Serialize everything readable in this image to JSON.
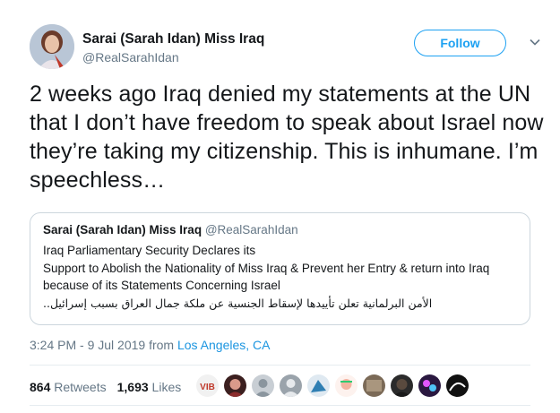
{
  "author": {
    "name": "Sarai (Sarah Idan) Miss Iraq",
    "handle": "@RealSarahIdan"
  },
  "follow_label": "Follow",
  "tweet_text": "2 weeks ago Iraq denied my statements at the UN that I don’t have freedom to speak about Israel now they’re taking my citizenship. This is inhumane. I’m speechless…",
  "quote": {
    "name": "Sarai (Sarah Idan) Miss Iraq",
    "handle": "@RealSarahIdan",
    "lines": [
      "Iraq Parliamentary Security Declares its",
      "Support to Abolish the Nationality of Miss Iraq & Prevent her Entry & return into Iraq",
      "because of its Statements Concerning Israel",
      "الأمن البرلمانية تعلن تأييدها لإسقاط الجنسية عن ملكة جمال العراق بسبب إسرائيل.."
    ]
  },
  "meta": {
    "time": "3:24 PM - 9 Jul 2019 from ",
    "location": "Los Angeles, CA"
  },
  "stats": {
    "retweets_count": "864",
    "retweets_label": "Retweets",
    "likes_count": "1,693",
    "likes_label": "Likes"
  },
  "colors": {
    "accent": "#1da1f2",
    "link": "#1b95e0",
    "secondary_text": "#657786",
    "border": "#ccd6dd"
  },
  "liker_avatars": [
    "avatar-1",
    "avatar-2",
    "avatar-3",
    "avatar-4",
    "avatar-5",
    "avatar-6",
    "avatar-7",
    "avatar-8",
    "avatar-9",
    "avatar-10"
  ]
}
